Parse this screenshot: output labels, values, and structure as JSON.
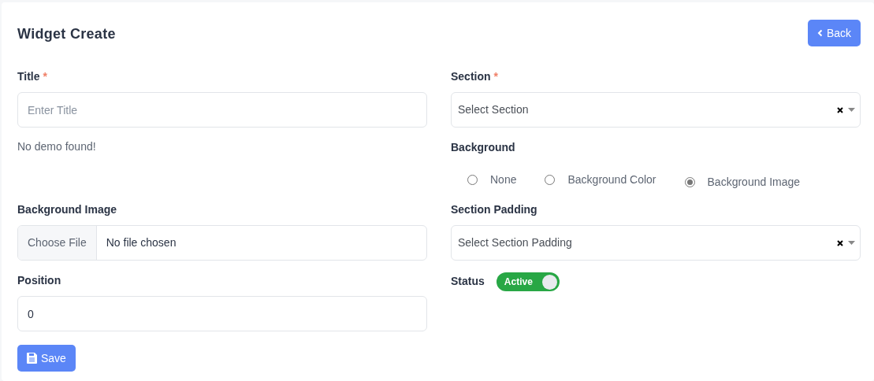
{
  "header": {
    "title": "Widget Create",
    "back_button": {
      "label": "Back"
    }
  },
  "title_field": {
    "label": "Title",
    "required_mark": "*",
    "placeholder": "Enter Title"
  },
  "section_field": {
    "label": "Section",
    "required_mark": "*",
    "placeholder": "Select Section"
  },
  "demo_message": "No demo found!",
  "background": {
    "label": "Background",
    "options": [
      {
        "label": "None",
        "selected": false
      },
      {
        "label": "Background Color",
        "selected": false
      },
      {
        "label": "Background Image",
        "selected": true
      }
    ]
  },
  "background_image": {
    "label": "Background Image",
    "button": "Choose File",
    "file_text": "No file chosen"
  },
  "section_padding": {
    "label": "Section Padding",
    "placeholder": "Select Section Padding"
  },
  "position": {
    "label": "Position",
    "value": "0"
  },
  "status": {
    "label": "Status",
    "on": true,
    "text": "Active"
  },
  "save_button": {
    "label": "Save"
  }
}
